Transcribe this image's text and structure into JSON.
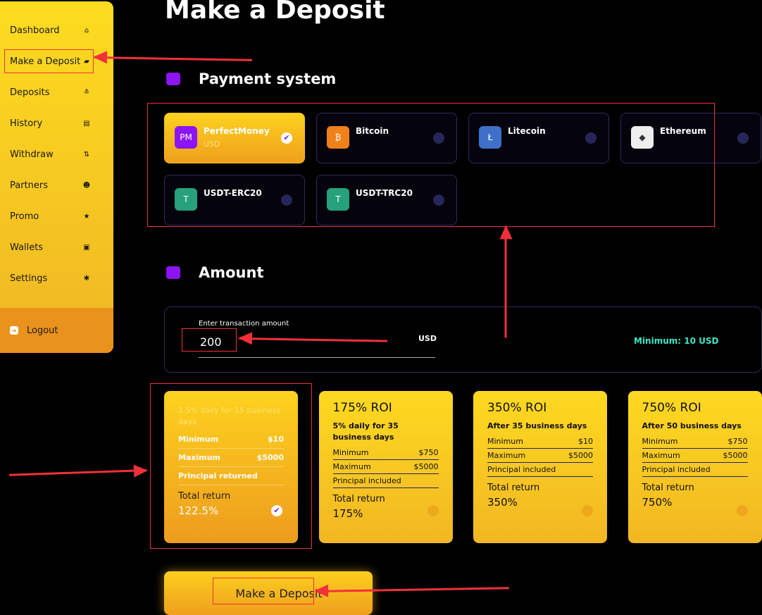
{
  "sidebar": {
    "items": [
      {
        "label": "Dashboard",
        "icon": "home-icon",
        "g": "⌂"
      },
      {
        "label": "Make a Deposit",
        "icon": "wallet-icon",
        "g": "▰"
      },
      {
        "label": "Deposits",
        "icon": "deposits-icon",
        "g": "≛"
      },
      {
        "label": "History",
        "icon": "history-icon",
        "g": "▤"
      },
      {
        "label": "Withdraw",
        "icon": "withdraw-icon",
        "g": "⇅"
      },
      {
        "label": "Partners",
        "icon": "users-icon",
        "g": "☻"
      },
      {
        "label": "Promo",
        "icon": "star-icon",
        "g": "★"
      },
      {
        "label": "Wallets",
        "icon": "wallets-icon",
        "g": "▣"
      },
      {
        "label": "Settings",
        "icon": "gear-icon",
        "g": "✱"
      }
    ],
    "logout": "Logout"
  },
  "page": {
    "title": "Make a Deposit"
  },
  "payment": {
    "heading": "Payment system",
    "methods": [
      {
        "name": "PerfectMoney",
        "currency": "USD",
        "logo": "PM",
        "selected": true,
        "color": "#8d14f5"
      },
      {
        "name": "Bitcoin",
        "logo": "₿",
        "color": "#f0801a"
      },
      {
        "name": "Litecoin",
        "logo": "Ł",
        "color": "#3f6fc9"
      },
      {
        "name": "Ethereum",
        "logo": "◆",
        "color": "#eeeeee"
      },
      {
        "name": "USDT-ERC20",
        "logo": "T",
        "color": "#26a17b"
      },
      {
        "name": "USDT-TRC20",
        "logo": "T",
        "color": "#26a17b"
      }
    ]
  },
  "amount": {
    "heading": "Amount",
    "label": "Enter transaction amount",
    "value": "200",
    "currency": "USD",
    "minimum": "Minimum: 10 USD"
  },
  "plans": [
    {
      "title": "",
      "desc": "1.5% daily for 15 business days",
      "min": "$10",
      "max": "$5000",
      "principal": "Principal returned",
      "total_label": "Total return",
      "total": "122.5%",
      "selected": true
    },
    {
      "title": "175% ROI",
      "desc": "5% daily for 35 business days",
      "min": "$750",
      "max": "$5000",
      "principal": "Principal included",
      "total_label": "Total return",
      "total": "175%"
    },
    {
      "title": "350% ROI",
      "desc": "After 35 business days",
      "min": "$10",
      "max": "$5000",
      "principal": "Principal included",
      "total_label": "Total return",
      "total": "350%"
    },
    {
      "title": "750% ROI",
      "desc": "After 50 business days",
      "min": "$750",
      "max": "$5000",
      "principal": "Principal included",
      "total_label": "Total return",
      "total": "750%"
    }
  ],
  "labels": {
    "minimum": "Minimum",
    "maximum": "Maximum"
  },
  "submit": "Make a Deposit",
  "colors": {
    "accent": "#fdd21e",
    "purple": "#8d14f5",
    "minimum": "#3ee6c4",
    "annotation": "#f0303a"
  }
}
